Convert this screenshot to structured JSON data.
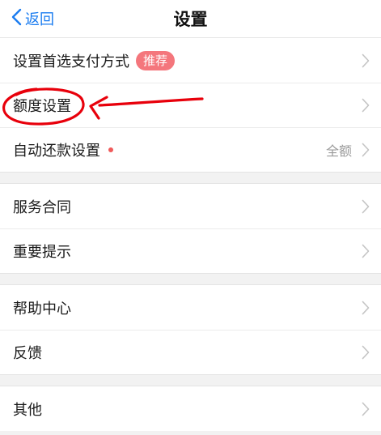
{
  "navbar": {
    "back_label": "返回",
    "title": "设置"
  },
  "groups": [
    {
      "rows": [
        {
          "label": "设置首选支付方式",
          "badge": "推荐"
        },
        {
          "label": "额度设置"
        },
        {
          "label": "自动还款设置",
          "value": "全额"
        }
      ]
    },
    {
      "rows": [
        {
          "label": "服务合同"
        },
        {
          "label": "重要提示"
        }
      ]
    },
    {
      "rows": [
        {
          "label": "帮助中心"
        },
        {
          "label": "反馈"
        }
      ]
    },
    {
      "rows": [
        {
          "label": "其他"
        }
      ]
    }
  ],
  "colors": {
    "accent": "#1a7cf0",
    "badge": "#f4767c",
    "annotation": "#e8000b",
    "dot": "#f05a5a"
  }
}
